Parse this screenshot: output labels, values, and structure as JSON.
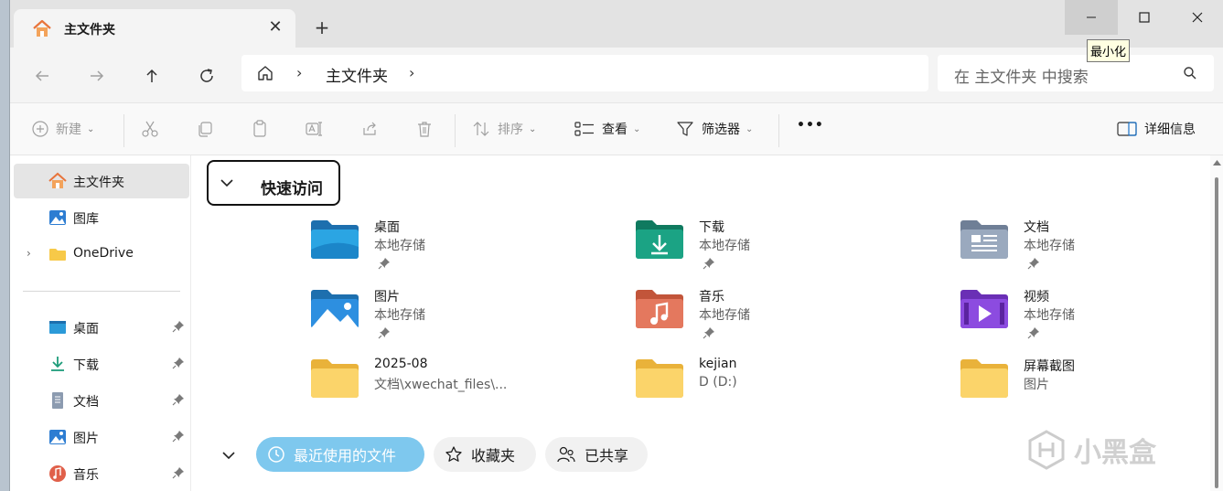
{
  "tab": {
    "title": "主文件夹",
    "close": "✕",
    "new_tab": "+"
  },
  "window_controls": {
    "minimize_tooltip": "最小化"
  },
  "address": {
    "path": "主文件夹",
    "chevron": "›"
  },
  "search": {
    "placeholder": "在 主文件夹 中搜索"
  },
  "commands": {
    "new": "新建",
    "sort": "排序",
    "view": "查看",
    "filter": "筛选器",
    "more": "•••",
    "details": "详细信息"
  },
  "sidebar": {
    "items": [
      {
        "label": "主文件夹",
        "icon": "home-icon"
      },
      {
        "label": "图库",
        "icon": "gallery-icon"
      },
      {
        "label": "OneDrive",
        "icon": "folder-icon"
      },
      {
        "label": "桌面",
        "icon": "desktop-icon"
      },
      {
        "label": "下载",
        "icon": "download-icon"
      },
      {
        "label": "文档",
        "icon": "document-icon"
      },
      {
        "label": "图片",
        "icon": "pictures-icon"
      },
      {
        "label": "音乐",
        "icon": "music-icon"
      }
    ],
    "expand": "›"
  },
  "quick_access": {
    "title": "快速访问",
    "items": [
      {
        "name": "桌面",
        "sub": "本地存储",
        "pinned": true,
        "icon": "desktop-folder-icon"
      },
      {
        "name": "下载",
        "sub": "本地存储",
        "pinned": true,
        "icon": "downloads-folder-icon"
      },
      {
        "name": "文档",
        "sub": "本地存储",
        "pinned": true,
        "icon": "documents-folder-icon"
      },
      {
        "name": "图片",
        "sub": "本地存储",
        "pinned": true,
        "icon": "pictures-folder-icon"
      },
      {
        "name": "音乐",
        "sub": "本地存储",
        "pinned": true,
        "icon": "music-folder-icon"
      },
      {
        "name": "视频",
        "sub": "本地存储",
        "pinned": true,
        "icon": "videos-folder-icon"
      },
      {
        "name": "2025-08",
        "sub": "文档\\xwechat_files\\...",
        "pinned": false,
        "icon": "folder-icon"
      },
      {
        "name": "kejian",
        "sub": "D (D:)",
        "pinned": false,
        "icon": "folder-icon"
      },
      {
        "name": "屏幕截图",
        "sub": "图片",
        "pinned": false,
        "icon": "folder-icon"
      }
    ]
  },
  "bottom_tabs": {
    "recent": "最近使用的文件",
    "favorites": "收藏夹",
    "shared": "已共享"
  },
  "watermark": {
    "text": "小黑盒"
  },
  "colors": {
    "accent": "#7ec8ee",
    "folder": "#f7c948",
    "selected": "#e5e5e5"
  }
}
